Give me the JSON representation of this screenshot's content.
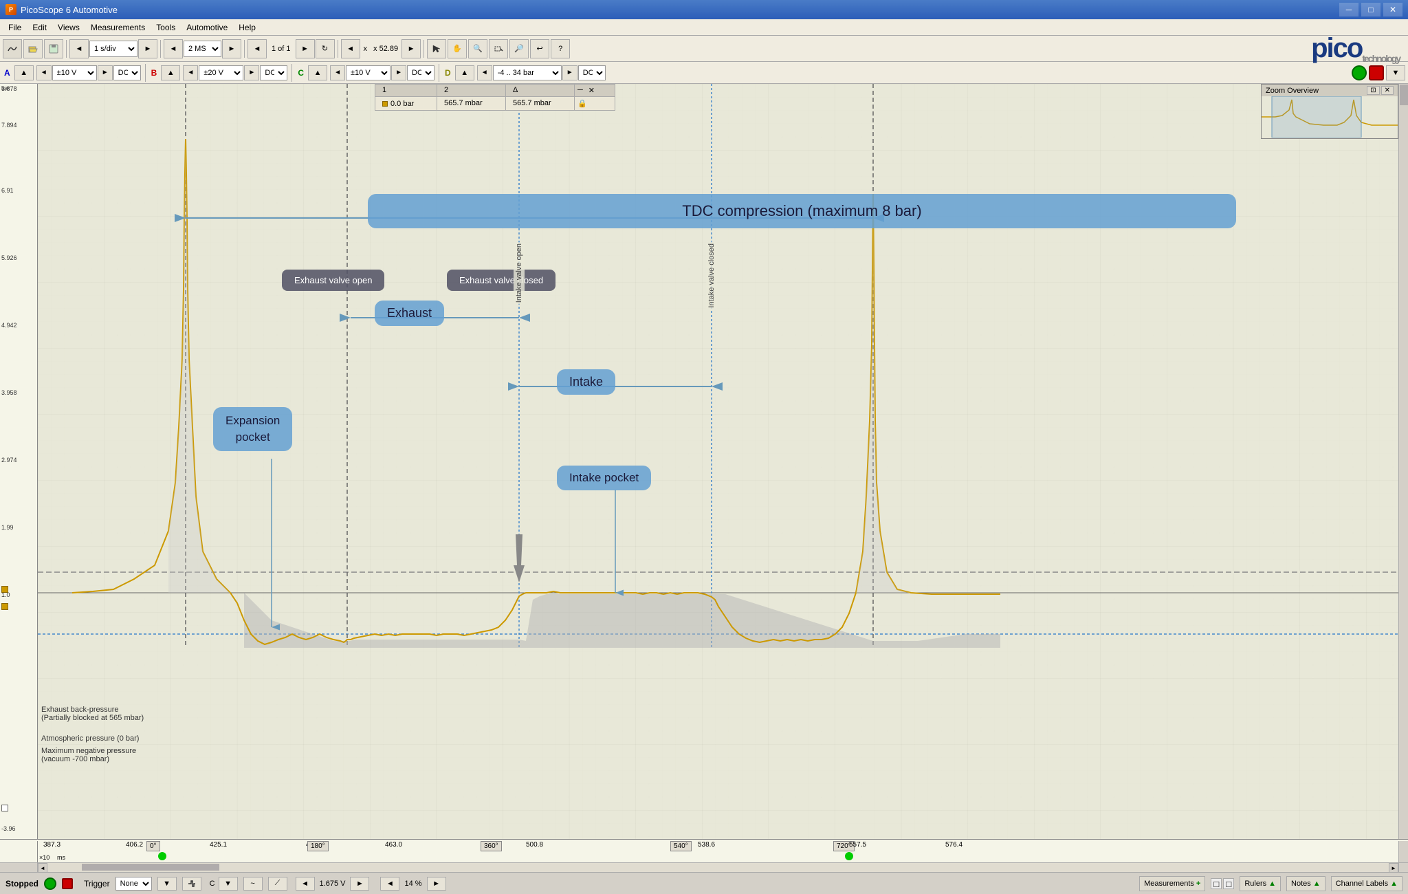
{
  "app": {
    "title": "PicoScope 6 Automotive"
  },
  "window_controls": {
    "minimize": "─",
    "maximize": "□",
    "close": "✕"
  },
  "menu": {
    "items": [
      "File",
      "Edit",
      "Views",
      "Measurements",
      "Tools",
      "Automotive",
      "Help"
    ]
  },
  "toolbar": {
    "time_div": "1 s/div",
    "samples": "2 MS",
    "page": "1 of 1",
    "zoom": "x 52.89"
  },
  "channels": {
    "a": {
      "label": "A",
      "voltage": "±10 V",
      "coupling": "DC"
    },
    "b": {
      "label": "B",
      "voltage": "±20 V",
      "coupling": "DC"
    },
    "c": {
      "label": "C",
      "voltage": "±10 V",
      "coupling": "DC"
    },
    "d": {
      "label": "D",
      "voltage": "-4 .. 34 bar",
      "coupling": "DC"
    }
  },
  "chart": {
    "y_labels": [
      "3.878 bar",
      "7.894",
      "6.91",
      "5.926",
      "4.942",
      "3.958",
      "2.974",
      "1.99",
      "1.0",
      "-3.96"
    ],
    "x_labels": [
      "387.3",
      "406.2",
      "425.1",
      "444.1",
      "463.0",
      "500.8",
      "538.6",
      "557.5",
      "576.4"
    ],
    "x_markers": [
      "0°",
      "180°",
      "360°",
      "540°",
      "720°"
    ],
    "unit": "ms",
    "x10": "×10"
  },
  "annotations": {
    "tdc_compression": "TDC compression (maximum 8 bar)",
    "exhaust_valve_open": "Exhaust valve open",
    "exhaust_valve_closed": "Exhaust valve closed",
    "exhaust": "Exhaust",
    "expansion_pocket": "Expansion pocket",
    "intake": "Intake",
    "intake_pocket": "Intake pocket",
    "intake_valve_open": "Intake valve open",
    "intake_valve_closed": "Intake valve closed",
    "exhaust_back_pressure": "Exhaust back-pressure",
    "exhaust_back_pressure2": "(Partially blocked at 565 mbar)",
    "atmospheric": "Atmospheric pressure (0 bar)",
    "vacuum": "Maximum negative pressure",
    "vacuum2": "(vacuum -700 mbar)"
  },
  "measurement_box": {
    "col1": "1",
    "col2": "2",
    "col_delta": "Δ",
    "val1": "0.0 bar",
    "val2": "565.7 mbar",
    "delta": "565.7 mbar",
    "close": "✕",
    "icon_color": "#cc9900"
  },
  "zoom_overview": {
    "title": "Zoom Overview",
    "restore": "⊡",
    "close": "✕"
  },
  "status_bar": {
    "stopped": "Stopped",
    "trigger": "Trigger",
    "trigger_value": "None",
    "voltage": "1.675 V",
    "percent": "14 %",
    "measurements": "Measurements",
    "rulers": "Rulers",
    "notes": "Notes",
    "channel_labels": "Channel Labels"
  },
  "pico_logo": "pico"
}
